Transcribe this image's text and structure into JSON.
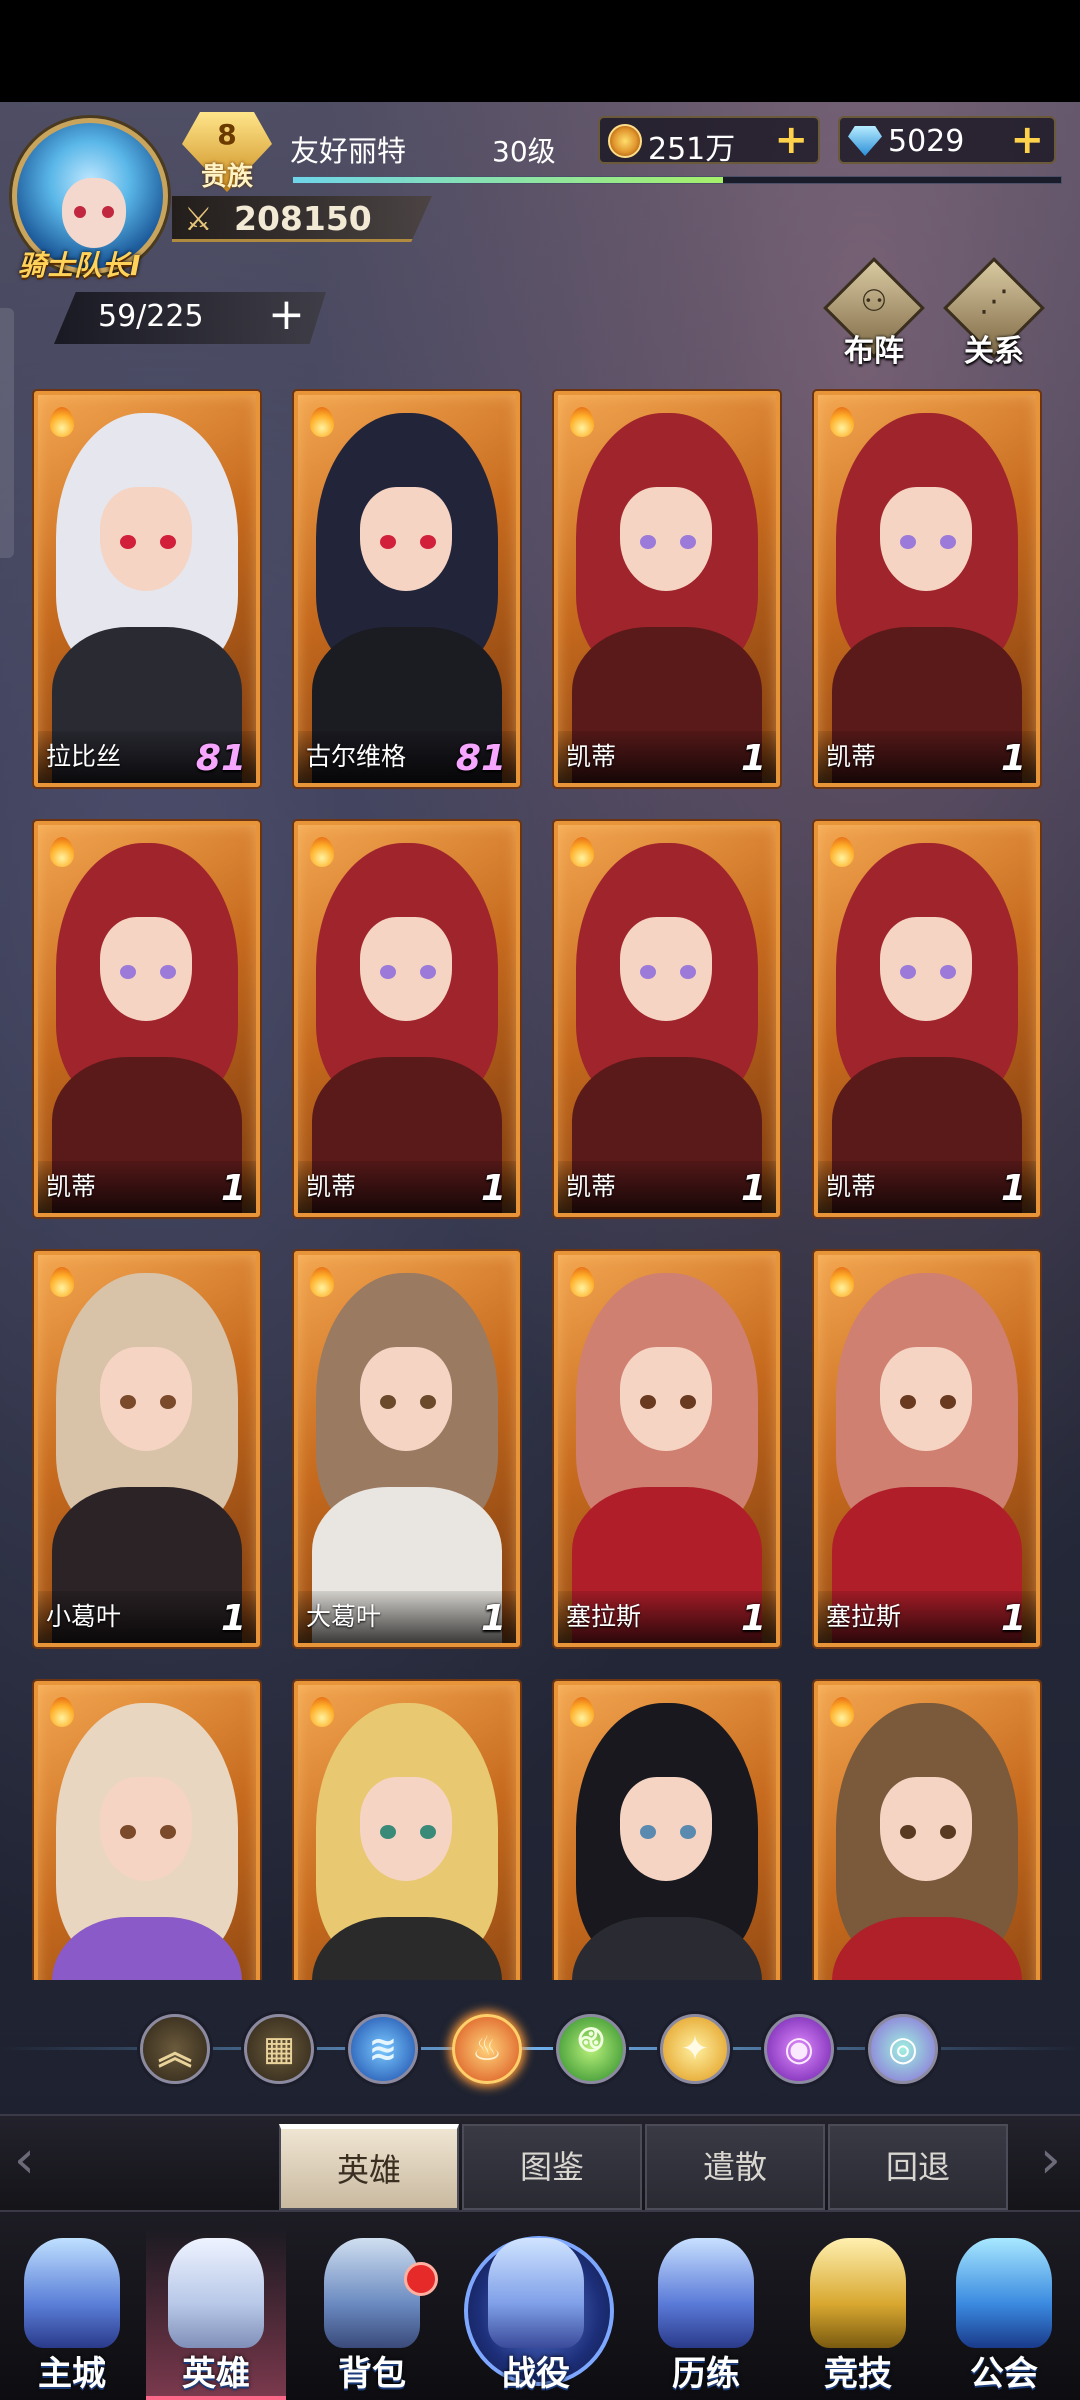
{
  "player": {
    "name": "友好丽特",
    "level": "30级",
    "title": "骑士队长Ⅰ",
    "vip_level": "8",
    "vip_label": "贵族",
    "power": "208150",
    "xp_progress_pct": 56
  },
  "resources": {
    "gold": "251万",
    "gems": "5029",
    "add": "+"
  },
  "heroes_count": "59/225",
  "top_buttons": {
    "formation": "布阵",
    "relation": "关系"
  },
  "heroes": [
    {
      "name": "拉比丝",
      "level": "81",
      "element": "fire"
    },
    {
      "name": "古尔维格",
      "level": "81",
      "element": "fire"
    },
    {
      "name": "凯蒂",
      "level": "1",
      "element": "fire"
    },
    {
      "name": "凯蒂",
      "level": "1",
      "element": "fire"
    },
    {
      "name": "凯蒂",
      "level": "1",
      "element": "fire"
    },
    {
      "name": "凯蒂",
      "level": "1",
      "element": "fire"
    },
    {
      "name": "凯蒂",
      "level": "1",
      "element": "fire"
    },
    {
      "name": "凯蒂",
      "level": "1",
      "element": "fire"
    },
    {
      "name": "小葛叶",
      "level": "1",
      "element": "fire"
    },
    {
      "name": "大葛叶",
      "level": "1",
      "element": "fire"
    },
    {
      "name": "塞拉斯",
      "level": "1",
      "element": "fire"
    },
    {
      "name": "塞拉斯",
      "level": "1",
      "element": "fire"
    },
    {
      "name": "",
      "level": "",
      "element": "fire"
    },
    {
      "name": "",
      "level": "",
      "element": "fire"
    },
    {
      "name": "",
      "level": "",
      "element": "fire"
    },
    {
      "name": "",
      "level": "",
      "element": "fire"
    }
  ],
  "element_filters": [
    "collapse",
    "all",
    "water",
    "fire",
    "wind",
    "light",
    "dark",
    "chaos"
  ],
  "element_filter_active": "fire",
  "sub_tabs": [
    "英雄",
    "图鉴",
    "遣散",
    "回退"
  ],
  "sub_tab_active": "英雄",
  "bottom_nav": [
    {
      "label": "主城",
      "icon": "castle-icon"
    },
    {
      "label": "英雄",
      "icon": "hero-portrait-icon"
    },
    {
      "label": "背包",
      "icon": "backpack-icon"
    },
    {
      "label": "战役",
      "icon": "crossed-swords-icon"
    },
    {
      "label": "历练",
      "icon": "hexagram-icon"
    },
    {
      "label": "竞技",
      "icon": "arena-sword-icon"
    },
    {
      "label": "公会",
      "icon": "guild-crest-icon"
    }
  ],
  "bottom_nav_active": "英雄"
}
